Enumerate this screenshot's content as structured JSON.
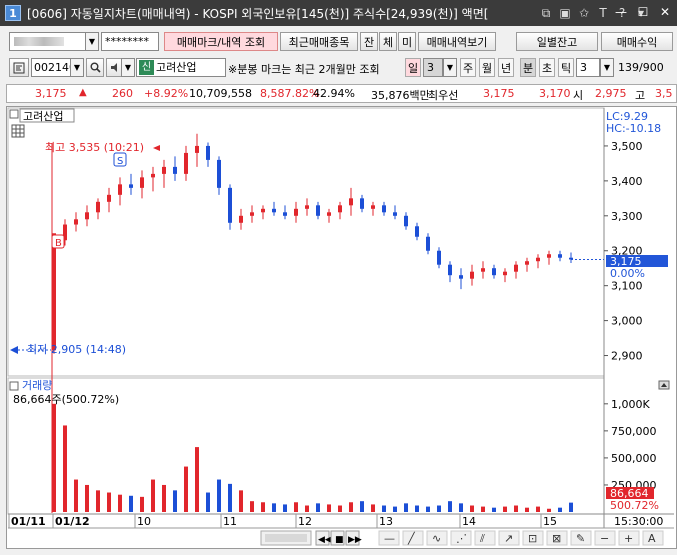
{
  "window": {
    "badge": "1",
    "title": "[0606] 자동일지차트(매매내역) - KOSPI 외국인보유[145(천)] 주식수[24,939(천)] 액면[",
    "icons": [
      "link-icon",
      "tile-icon",
      "star-icon",
      "text-icon",
      "help-icon",
      "hat-icon"
    ],
    "icon_glyphs": [
      "⧉",
      "▣",
      "✩",
      "T",
      "?",
      "▾"
    ],
    "min": "—",
    "max": "☐",
    "close": "✕"
  },
  "toolbar": {
    "password": "********",
    "btn_trade_mark": "매매마크/내역 조회",
    "btn_recent": "최근매매종목",
    "btn_jan": "잔",
    "btn_che": "체",
    "btn_mi": "미",
    "btn_history": "매매내역보기",
    "btn_daily": "일별잔고",
    "btn_profit": "매매수익"
  },
  "stock_bar": {
    "code": "002140",
    "sin": "신",
    "name": "고려산업",
    "note": "※분봉 마크는 최근 2개월만 조회",
    "periods": [
      "일",
      "주",
      "월",
      "년",
      "분",
      "초",
      "틱"
    ],
    "day_num": "3",
    "tick_num": "3",
    "counter": "139/900"
  },
  "quote": {
    "price": "3,175",
    "change": "260",
    "change_pct": "+8.92%",
    "volume": "10,709,558",
    "vol_ratio": "8,587.82%",
    "turnover": "42.94%",
    "amount": "35,876백만",
    "priority_label": "최우선",
    "ask": "3,175",
    "bid": "3,170",
    "open_label": "시",
    "open": "2,975",
    "high_label": "고",
    "high_partial": "3,5"
  },
  "chart": {
    "stock_label": "고려산업",
    "lc_label": "LC:9.29",
    "hc_label": "HC:-10.18",
    "max_annot": "최고 3,535 (10:21)",
    "min_annot": "최저 2,905 (14:48)",
    "price_axis": [
      "3,500",
      "3,400",
      "3,300",
      "3,200",
      "3,100",
      "3,000",
      "2,900"
    ],
    "current_price": "3,175",
    "current_pct": "0.00%",
    "buy_mark": "B",
    "sell_mark": "S",
    "volume_label": "거래량",
    "volume_value": "86,664주(500.72%)",
    "volume_axis": [
      "1,000K",
      "750,000",
      "500,000",
      "250,000"
    ],
    "current_volume": "86,664",
    "current_volume_pct": "500.72%",
    "x_labels": [
      "01/11",
      "01/12",
      "10",
      "11",
      "12",
      "13",
      "14",
      "15"
    ],
    "time_label": "15:30:00",
    "colors": {
      "up": "#e1262c",
      "down": "#1c4fd6",
      "price_tag": "#2256d8",
      "vol_tag": "#e1262c"
    }
  },
  "chart_data": {
    "type": "candlestick",
    "price_range": [
      2850,
      3600
    ],
    "volume_range": [
      0,
      1100000
    ],
    "high": 3535,
    "low": 2905,
    "last": 3175,
    "ohlc_approx": [
      [
        2915,
        2905,
        3230,
        3250
      ],
      [
        3230,
        3215,
        3290,
        3275
      ],
      [
        3275,
        3255,
        3310,
        3290
      ],
      [
        3290,
        3270,
        3330,
        3310
      ],
      [
        3310,
        3290,
        3350,
        3340
      ],
      [
        3340,
        3310,
        3380,
        3360
      ],
      [
        3360,
        3330,
        3410,
        3390
      ],
      [
        3390,
        3360,
        3420,
        3380
      ],
      [
        3380,
        3350,
        3430,
        3410
      ],
      [
        3410,
        3370,
        3440,
        3420
      ],
      [
        3420,
        3380,
        3460,
        3440
      ],
      [
        3440,
        3400,
        3470,
        3420
      ],
      [
        3420,
        3400,
        3500,
        3480
      ],
      [
        3480,
        3440,
        3535,
        3500
      ],
      [
        3500,
        3440,
        3510,
        3460
      ],
      [
        3460,
        3360,
        3470,
        3380
      ],
      [
        3380,
        3260,
        3390,
        3280
      ],
      [
        3280,
        3260,
        3320,
        3300
      ],
      [
        3300,
        3280,
        3330,
        3310
      ],
      [
        3310,
        3290,
        3330,
        3320
      ],
      [
        3320,
        3300,
        3340,
        3310
      ],
      [
        3310,
        3290,
        3330,
        3300
      ],
      [
        3300,
        3280,
        3340,
        3320
      ],
      [
        3320,
        3300,
        3350,
        3330
      ],
      [
        3330,
        3290,
        3340,
        3300
      ],
      [
        3300,
        3280,
        3320,
        3310
      ],
      [
        3310,
        3290,
        3340,
        3330
      ],
      [
        3330,
        3300,
        3380,
        3350
      ],
      [
        3350,
        3310,
        3360,
        3320
      ],
      [
        3320,
        3300,
        3340,
        3330
      ],
      [
        3330,
        3300,
        3340,
        3310
      ],
      [
        3310,
        3290,
        3330,
        3300
      ],
      [
        3300,
        3260,
        3310,
        3270
      ],
      [
        3270,
        3230,
        3280,
        3240
      ],
      [
        3240,
        3190,
        3250,
        3200
      ],
      [
        3200,
        3150,
        3210,
        3160
      ],
      [
        3160,
        3110,
        3170,
        3130
      ],
      [
        3130,
        3090,
        3150,
        3120
      ],
      [
        3120,
        3100,
        3160,
        3140
      ],
      [
        3140,
        3120,
        3170,
        3150
      ],
      [
        3150,
        3120,
        3160,
        3130
      ],
      [
        3130,
        3110,
        3150,
        3140
      ],
      [
        3140,
        3120,
        3170,
        3160
      ],
      [
        3160,
        3140,
        3180,
        3170
      ],
      [
        3170,
        3150,
        3190,
        3180
      ],
      [
        3180,
        3160,
        3200,
        3190
      ],
      [
        3190,
        3170,
        3200,
        3180
      ],
      [
        3180,
        3165,
        3195,
        3175
      ]
    ],
    "volume_approx": [
      1000000,
      800000,
      300000,
      250000,
      200000,
      180000,
      160000,
      150000,
      140000,
      300000,
      250000,
      200000,
      420000,
      600000,
      180000,
      300000,
      260000,
      200000,
      100000,
      90000,
      80000,
      70000,
      90000,
      60000,
      80000,
      70000,
      60000,
      90000,
      100000,
      70000,
      60000,
      50000,
      80000,
      60000,
      50000,
      60000,
      100000,
      80000,
      60000,
      50000,
      40000,
      50000,
      60000,
      40000,
      50000,
      30000,
      40000,
      86664
    ]
  }
}
